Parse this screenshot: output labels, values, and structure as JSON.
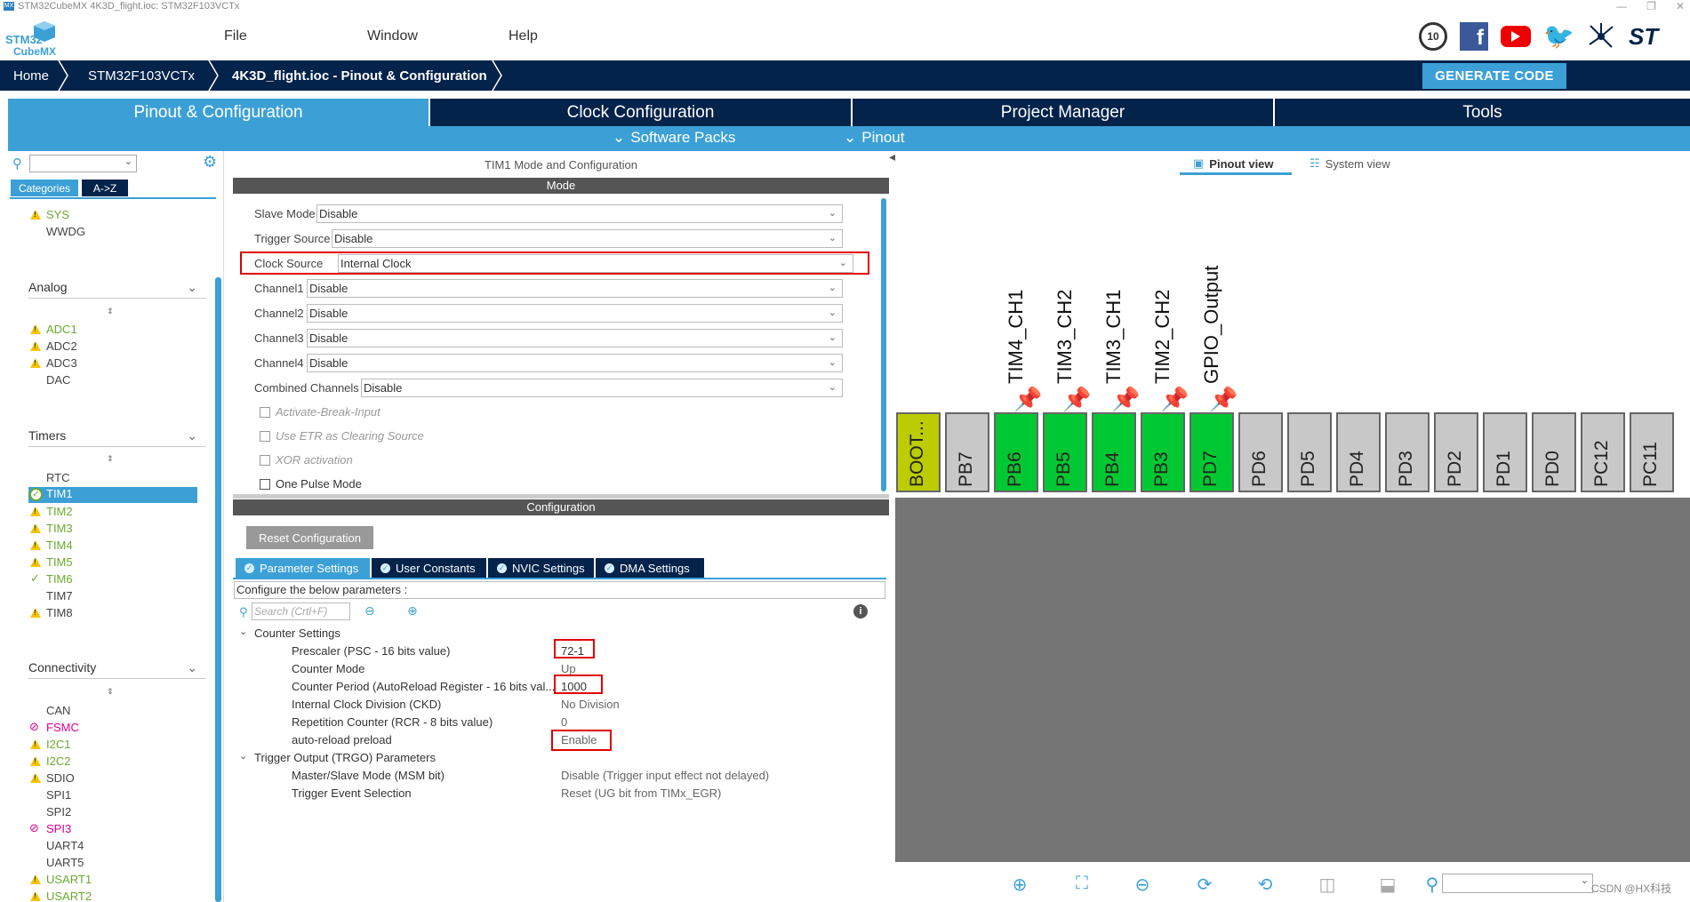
{
  "window": {
    "title": "STM32CubeMX 4K3D_flight.ioc: STM32F103VCTx"
  },
  "logo": {
    "line1": "STM32",
    "line2": "CubeMX"
  },
  "menu": {
    "file": "File",
    "window": "Window",
    "help": "Help"
  },
  "breadcrumb": {
    "home": "Home",
    "chip": "STM32F103VCTx",
    "current": "4K3D_flight.ioc - Pinout & Configuration"
  },
  "generate_code": "GENERATE CODE",
  "tabs": [
    {
      "label": "Pinout & Configuration",
      "active": true
    },
    {
      "label": "Clock Configuration",
      "active": false
    },
    {
      "label": "Project Manager",
      "active": false
    },
    {
      "label": "Tools",
      "active": false
    }
  ],
  "subtabs": {
    "software_packs": "Software Packs",
    "pinout": "Pinout"
  },
  "left": {
    "cat_tabs": {
      "categories": "Categories",
      "az": "A->Z"
    },
    "system_items": [
      {
        "label": "SYS",
        "status": "warn"
      },
      {
        "label": "WWDG",
        "status": "none"
      }
    ],
    "analog": {
      "title": "Analog",
      "items": [
        {
          "label": "ADC1",
          "status": "warn"
        },
        {
          "label": "ADC2",
          "status": "warn"
        },
        {
          "label": "ADC3",
          "status": "warn"
        },
        {
          "label": "DAC",
          "status": "none"
        }
      ]
    },
    "timers": {
      "title": "Timers",
      "items": [
        {
          "label": "RTC",
          "status": "none"
        },
        {
          "label": "TIM1",
          "status": "selected"
        },
        {
          "label": "TIM2",
          "status": "warn"
        },
        {
          "label": "TIM3",
          "status": "warn"
        },
        {
          "label": "TIM4",
          "status": "warn"
        },
        {
          "label": "TIM5",
          "status": "warn"
        },
        {
          "label": "TIM6",
          "status": "ok"
        },
        {
          "label": "TIM7",
          "status": "none"
        },
        {
          "label": "TIM8",
          "status": "warn"
        }
      ]
    },
    "connectivity": {
      "title": "Connectivity",
      "items": [
        {
          "label": "CAN",
          "status": "none"
        },
        {
          "label": "FSMC",
          "status": "err"
        },
        {
          "label": "I2C1",
          "status": "warn"
        },
        {
          "label": "I2C2",
          "status": "warn"
        },
        {
          "label": "SDIO",
          "status": "warn"
        },
        {
          "label": "SPI1",
          "status": "none"
        },
        {
          "label": "SPI2",
          "status": "none"
        },
        {
          "label": "SPI3",
          "status": "err"
        },
        {
          "label": "UART4",
          "status": "none"
        },
        {
          "label": "UART5",
          "status": "none"
        },
        {
          "label": "USART1",
          "status": "warn"
        },
        {
          "label": "USART2",
          "status": "warn"
        }
      ]
    }
  },
  "mode": {
    "panel_title": "TIM1 Mode and Configuration",
    "section": "Mode",
    "fields": [
      {
        "label": "Slave Mode",
        "value": "Disable"
      },
      {
        "label": "Trigger Source",
        "value": "Disable"
      },
      {
        "label": "Clock Source",
        "value": "Internal Clock"
      },
      {
        "label": "Channel1",
        "value": "Disable"
      },
      {
        "label": "Channel2",
        "value": "Disable"
      },
      {
        "label": "Channel3",
        "value": "Disable"
      },
      {
        "label": "Channel4",
        "value": "Disable"
      },
      {
        "label": "Combined Channels",
        "value": "Disable"
      }
    ],
    "checks": [
      {
        "label": "Activate-Break-Input",
        "enabled": false
      },
      {
        "label": "Use ETR as Clearing Source",
        "enabled": false
      },
      {
        "label": "XOR activation",
        "enabled": false
      },
      {
        "label": "One Pulse Mode",
        "enabled": true
      }
    ]
  },
  "config": {
    "section": "Configuration",
    "reset": "Reset Configuration",
    "tabs": [
      "Parameter Settings",
      "User Constants",
      "NVIC Settings",
      "DMA Settings"
    ],
    "hint": "Configure the below parameters :",
    "search_placeholder": "Search (Crtl+F)",
    "groups": [
      {
        "title": "Counter Settings",
        "params": [
          {
            "name": "Prescaler (PSC - 16 bits value)",
            "value": "72-1"
          },
          {
            "name": "Counter Mode",
            "value": "Up"
          },
          {
            "name": "Counter Period (AutoReload Register - 16 bits val...",
            "value": "1000"
          },
          {
            "name": "Internal Clock Division (CKD)",
            "value": "No Division"
          },
          {
            "name": "Repetition Counter (RCR - 8 bits value)",
            "value": "0"
          },
          {
            "name": "auto-reload preload",
            "value": "Enable"
          }
        ]
      },
      {
        "title": "Trigger Output (TRGO) Parameters",
        "params": [
          {
            "name": "Master/Slave Mode (MSM bit)",
            "value": "Disable (Trigger input effect not delayed)"
          },
          {
            "name": "Trigger Event Selection",
            "value": "Reset (UG bit from TIMx_EGR)"
          }
        ]
      }
    ]
  },
  "pinout": {
    "views": {
      "pinout": "Pinout view",
      "system": "System view"
    },
    "pins": [
      {
        "name": "BOOT...",
        "state": "boot"
      },
      {
        "name": "PB7",
        "state": "free"
      },
      {
        "name": "PB6",
        "state": "used",
        "signal": "TIM4_CH1"
      },
      {
        "name": "PB5",
        "state": "used",
        "signal": "TIM3_CH2"
      },
      {
        "name": "PB4",
        "state": "used",
        "signal": "TIM3_CH1"
      },
      {
        "name": "PB3",
        "state": "used",
        "signal": "TIM2_CH2"
      },
      {
        "name": "PD7",
        "state": "used",
        "signal": "GPIO_Output"
      },
      {
        "name": "PD6",
        "state": "free"
      },
      {
        "name": "PD5",
        "state": "free"
      },
      {
        "name": "PD4",
        "state": "free"
      },
      {
        "name": "PD3",
        "state": "free"
      },
      {
        "name": "PD2",
        "state": "free"
      },
      {
        "name": "PD1",
        "state": "free"
      },
      {
        "name": "PD0",
        "state": "free"
      },
      {
        "name": "PC12",
        "state": "free"
      },
      {
        "name": "PC11",
        "state": "free"
      }
    ]
  },
  "watermark": "CSDN @HX科技"
}
